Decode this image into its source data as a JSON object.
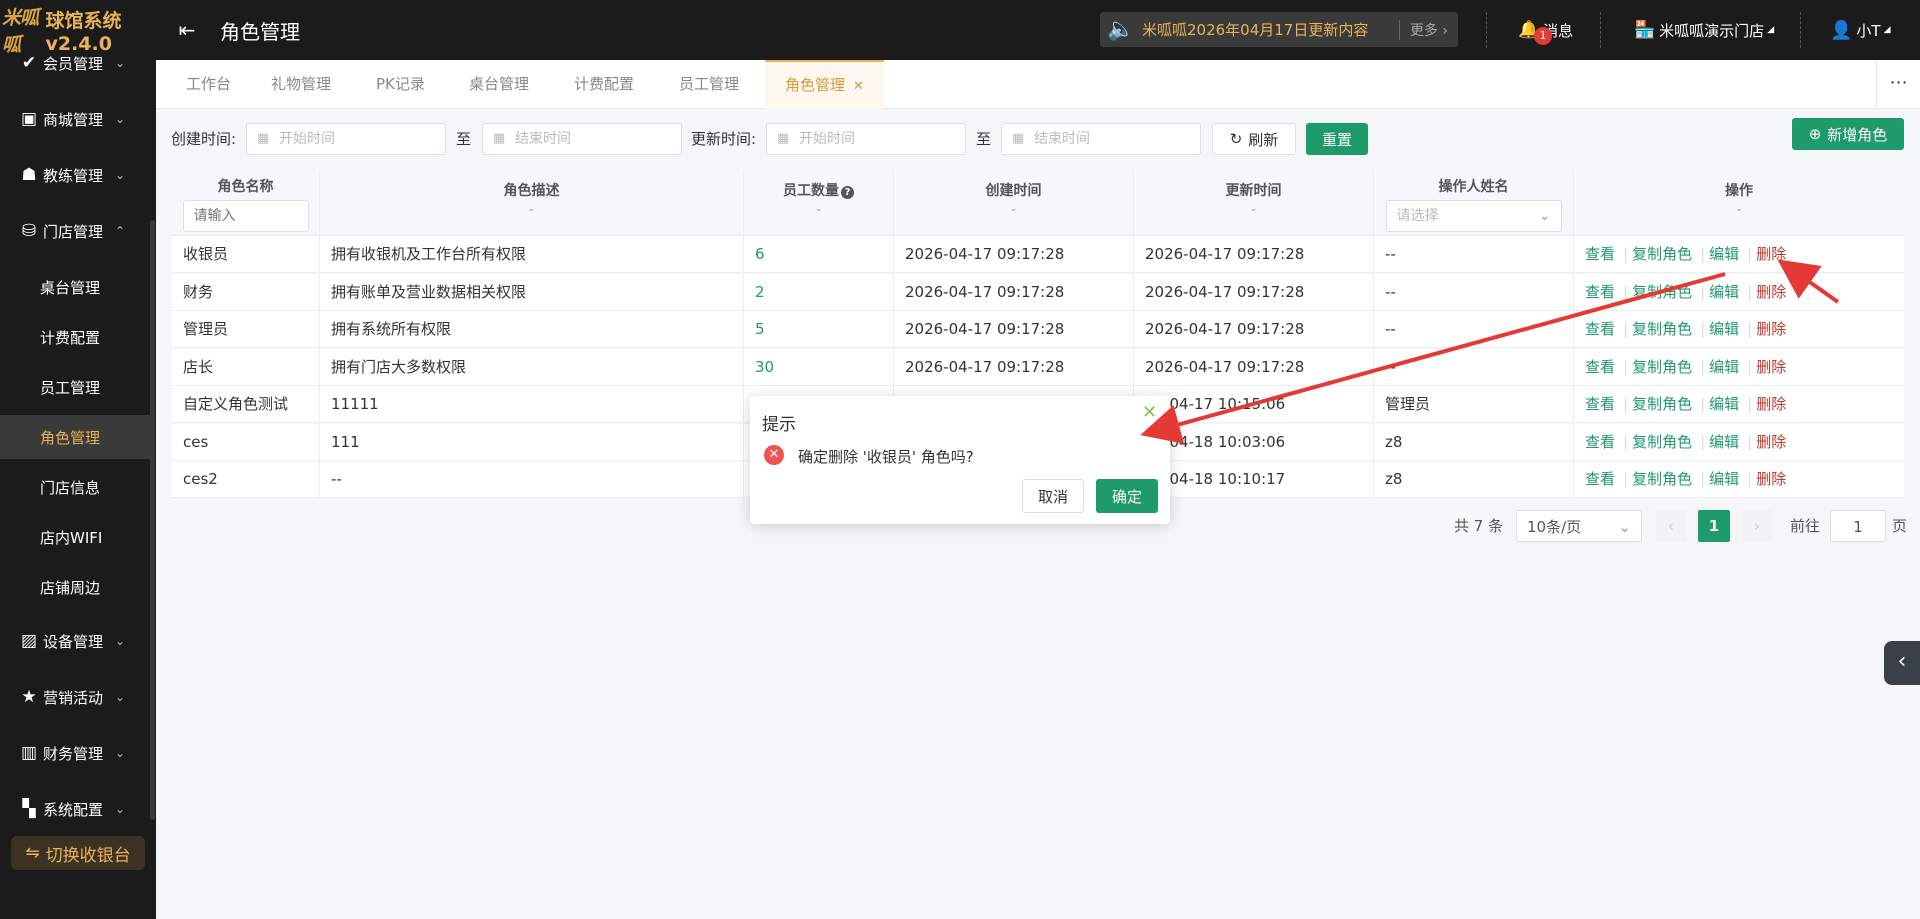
{
  "app": {
    "logo_text": "米呱呱",
    "name": "球馆系统 v2.4.0",
    "page_title": "角色管理"
  },
  "topbar": {
    "notice_text": "米呱呱2026年04月17日更新内容",
    "notice_more": "更多",
    "messages_label": "消息",
    "messages_badge": "1",
    "store_name": "米呱呱演示门店",
    "user_name": "小T"
  },
  "sidebar": {
    "groups": [
      {
        "label": "会员管理",
        "icon": "member-icon"
      },
      {
        "label": "商城管理",
        "icon": "mall-icon"
      },
      {
        "label": "教练管理",
        "icon": "coach-icon"
      },
      {
        "label": "门店管理",
        "icon": "store-icon"
      },
      {
        "label": "设备管理",
        "icon": "device-icon"
      },
      {
        "label": "营销活动",
        "icon": "marketing-icon"
      },
      {
        "label": "财务管理",
        "icon": "finance-icon"
      },
      {
        "label": "系统配置",
        "icon": "system-icon"
      }
    ],
    "subitems": [
      "桌台管理",
      "计费配置",
      "员工管理",
      "角色管理",
      "门店信息",
      "店内WIFI",
      "店铺周边"
    ],
    "active_subitem": "角色管理",
    "switch_label": "切换收银台"
  },
  "tabs": [
    "工作台",
    "礼物管理",
    "PK记录",
    "桌台管理",
    "计费配置",
    "员工管理",
    "角色管理"
  ],
  "active_tab": "角色管理",
  "filters": {
    "created_label": "创建时间:",
    "updated_label": "更新时间:",
    "start_placeholder": "开始时间",
    "end_placeholder": "结束时间",
    "to": "至",
    "refresh": "刷新",
    "reset": "重置",
    "add": "新增角色"
  },
  "table": {
    "headers": [
      "角色名称",
      "角色描述",
      "员工数量",
      "创建时间",
      "更新时间",
      "操作人姓名",
      "操作"
    ],
    "dash": "-",
    "name_placeholder": "请输入",
    "operator_placeholder": "请选择",
    "rows": [
      {
        "name": "收银员",
        "desc": "拥有收银机及工作台所有权限",
        "count": "6",
        "created": "2026-04-17 09:17:28",
        "updated": "2026-04-17 09:17:28",
        "operator": "--"
      },
      {
        "name": "财务",
        "desc": "拥有账单及营业数据相关权限",
        "count": "2",
        "created": "2026-04-17 09:17:28",
        "updated": "2026-04-17 09:17:28",
        "operator": "--"
      },
      {
        "name": "管理员",
        "desc": "拥有系统所有权限",
        "count": "5",
        "created": "2026-04-17 09:17:28",
        "updated": "2026-04-17 09:17:28",
        "operator": "--"
      },
      {
        "name": "店长",
        "desc": "拥有门店大多数权限",
        "count": "30",
        "created": "2026-04-17 09:17:28",
        "updated": "2026-04-17 09:17:28",
        "operator": "--"
      },
      {
        "name": "自定义角色测试",
        "desc": "11111",
        "count": "",
        "created": "",
        "updated": "26-04-17 10:15:06",
        "operator": "管理员"
      },
      {
        "name": "ces",
        "desc": "111",
        "count": "",
        "created": "",
        "updated": "26-04-18 10:03:06",
        "operator": "z8"
      },
      {
        "name": "ces2",
        "desc": "--",
        "count": "",
        "created": "",
        "updated": "26-04-18 10:10:17",
        "operator": "z8"
      }
    ],
    "actions": [
      "查看",
      "复制角色",
      "编辑",
      "删除"
    ]
  },
  "pagination": {
    "total": "共 7 条",
    "page_size": "10条/页",
    "current": "1",
    "goto_label": "前往",
    "goto_value": "1",
    "page_unit": "页"
  },
  "dialog": {
    "title": "提示",
    "message": "确定删除 '收银员' 角色吗?",
    "cancel": "取消",
    "confirm": "确定"
  },
  "colors": {
    "accent": "#1e9a6b",
    "danger": "#c0392b",
    "gold": "#e8b356",
    "annotation": "#e53935"
  }
}
